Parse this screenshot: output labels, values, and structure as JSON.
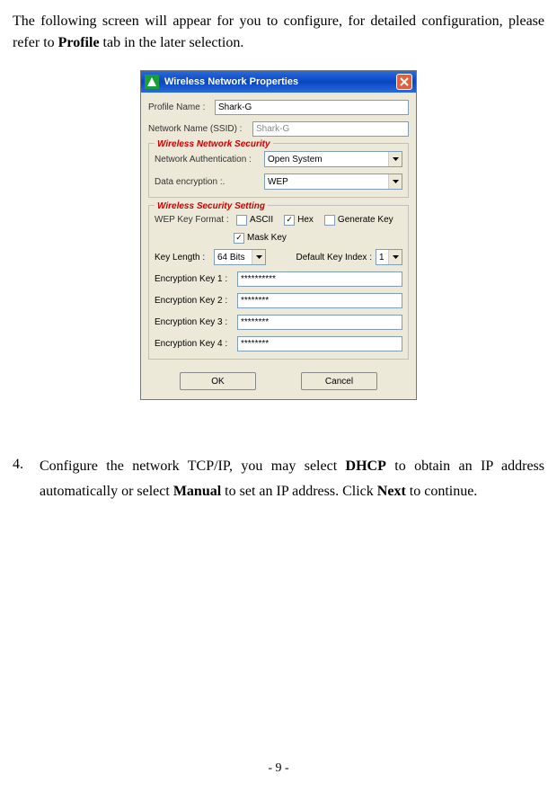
{
  "intro": {
    "part1": "The following screen will appear for you to configure, for detailed configuration, please refer to ",
    "bold": "Profile",
    "part2": " tab in the later selection."
  },
  "dialog": {
    "title": "Wireless Network Properties",
    "profile_name_label": "Profile Name :",
    "profile_name_value": "Shark-G",
    "ssid_label": "Network Name (SSID) :",
    "ssid_value": "Shark-G",
    "security_legend": "Wireless Network Security",
    "auth_label": "Network Authentication :",
    "auth_value": "Open System",
    "encryption_label": "Data encryption :.",
    "encryption_value": "WEP",
    "setting_legend": "Wireless Security Setting",
    "wep_format_label": "WEP Key Format :",
    "ascii_label": "ASCII",
    "hex_label": "Hex",
    "genkey_label": "Generate Key",
    "maskkey_label": "Mask Key",
    "keylen_label": "Key Length :",
    "keylen_value": "64 Bits",
    "default_idx_label": "Default Key Index :",
    "default_idx_value": "1",
    "enc_key_labels": [
      "Encryption Key 1 :",
      "Encryption Key 2 :",
      "Encryption Key 3 :",
      "Encryption Key 4 :"
    ],
    "enc_key_vals": [
      "**********",
      "********",
      "********",
      "********"
    ],
    "ok_label": "OK",
    "cancel_label": "Cancel"
  },
  "step4": {
    "num": "4.",
    "p1": "Configure the network TCP/IP, you may select ",
    "b1": "DHCP",
    "p2": " to obtain an IP address automatically or select ",
    "b2": "Manual",
    "p3": " to set an IP address. Click ",
    "b3": "Next",
    "p4": " to continue."
  },
  "page_number": "- 9 -"
}
